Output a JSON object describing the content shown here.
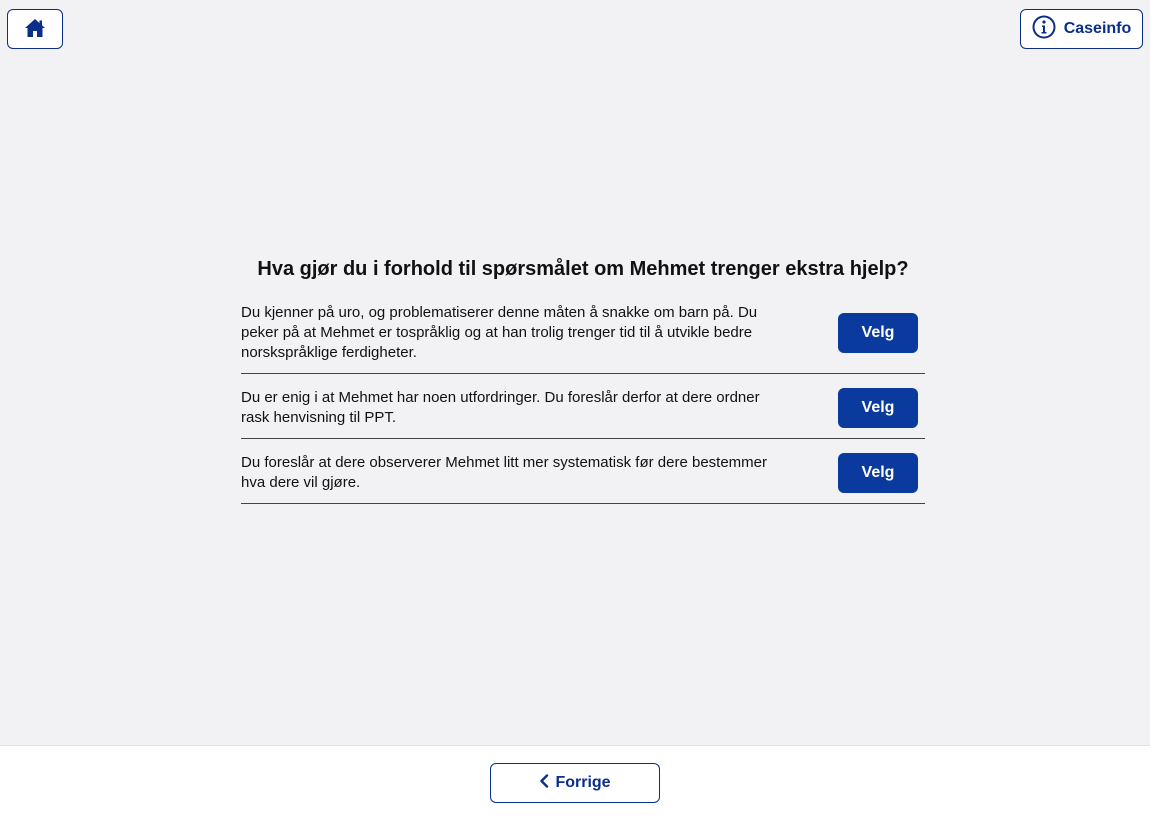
{
  "header": {
    "home_icon": "home-icon",
    "caseinfo_icon": "info-circle-icon",
    "caseinfo_label": "Caseinfo"
  },
  "main": {
    "question": "Hva gjør du i forhold til spørsmålet om Mehmet trenger ekstra hjelp?",
    "options": [
      {
        "text": "Du kjenner på uro, og problematiserer denne måten å snakke om barn på. Du peker på at Mehmet er tospråklig og at han trolig trenger tid til å utvikle bedre norskspråklige ferdigheter.",
        "button_label": "Velg"
      },
      {
        "text": "Du er enig i at Mehmet har noen utfordringer. Du foreslår derfor at dere ordner rask henvisning til PPT.",
        "button_label": "Velg"
      },
      {
        "text": "Du foreslår at dere observerer Mehmet litt mer systematisk før dere bestemmer hva dere vil gjøre.",
        "button_label": "Velg"
      }
    ]
  },
  "footer": {
    "back_icon": "chevron-left-icon",
    "back_label": "Forrige"
  },
  "colors": {
    "accent": "#0b3a9e",
    "background": "#f2f2f5",
    "footer_background": "#ffffff"
  }
}
